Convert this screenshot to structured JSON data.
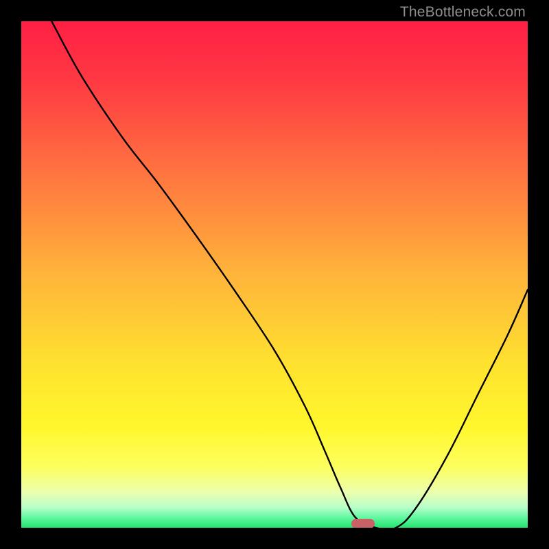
{
  "watermark": "TheBottleneck.com",
  "marker": {
    "x_pct": 67.5,
    "y_pct": 99.2
  },
  "gradient_stops": [
    {
      "pct": 0,
      "color": "#ff1f44"
    },
    {
      "pct": 12,
      "color": "#ff3a43"
    },
    {
      "pct": 30,
      "color": "#ff7440"
    },
    {
      "pct": 50,
      "color": "#ffb43a"
    },
    {
      "pct": 68,
      "color": "#ffe22f"
    },
    {
      "pct": 80,
      "color": "#fff72c"
    },
    {
      "pct": 88,
      "color": "#fdff5e"
    },
    {
      "pct": 93,
      "color": "#ecffae"
    },
    {
      "pct": 96,
      "color": "#b7ffca"
    },
    {
      "pct": 98,
      "color": "#61f8a0"
    },
    {
      "pct": 100,
      "color": "#23e36e"
    }
  ],
  "chart_data": {
    "type": "line",
    "title": "",
    "xlabel": "",
    "ylabel": "",
    "xlim": [
      0,
      100
    ],
    "ylim": [
      0,
      100
    ],
    "note": "y is the bottleneck mismatch percentage; 0 = optimal (green), 100 = worst (red). Curve dips to ~0 at the marker.",
    "series": [
      {
        "name": "bottleneck-curve",
        "x": [
          6,
          12,
          20,
          27,
          35,
          42,
          50,
          56,
          60,
          63,
          66,
          70,
          74,
          78,
          84,
          90,
          96,
          100
        ],
        "y": [
          100,
          89,
          77,
          68,
          57,
          47,
          35,
          24,
          15,
          8,
          2,
          0,
          0,
          4,
          14,
          26,
          38,
          47
        ]
      }
    ],
    "marker": {
      "x": 67.5,
      "y": 0.8
    }
  }
}
